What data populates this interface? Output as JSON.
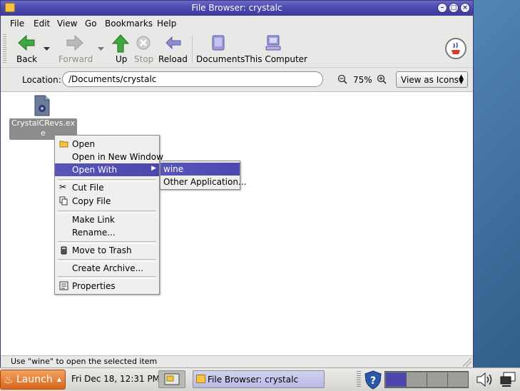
{
  "window": {
    "title": "File Browser: crystalc"
  },
  "menubar": [
    {
      "label": "File"
    },
    {
      "label": "Edit"
    },
    {
      "label": "View"
    },
    {
      "label": "Go"
    },
    {
      "label": "Bookmarks"
    },
    {
      "label": "Help"
    }
  ],
  "toolbar": {
    "back": "Back",
    "forward": "Forward",
    "up": "Up",
    "stop": "Stop",
    "reload": "Reload",
    "documents": "Documents",
    "this_computer": "This Computer"
  },
  "location": {
    "label": "Location:",
    "value": "/Documents/crystalc",
    "zoom": "75%",
    "view_mode": "View as Icons"
  },
  "file": {
    "name": "CrystalCRevs.exe"
  },
  "context_menu": {
    "open": "Open",
    "open_new_window": "Open in New Window",
    "open_with": "Open With",
    "cut": "Cut File",
    "copy": "Copy File",
    "make_link": "Make Link",
    "rename": "Rename...",
    "trash": "Move to Trash",
    "archive": "Create Archive...",
    "properties": "Properties"
  },
  "submenu": {
    "wine": "wine",
    "other": "Other Application..."
  },
  "status": "Use \"wine\" to open the selected item",
  "panel": {
    "launch": "Launch",
    "clock": "Fri Dec 18, 12:31 PM",
    "task": "File Browser: crystalc"
  },
  "colors": {
    "titlebar": "#4b47ad",
    "highlight": "#5a55bb",
    "launch": "#e07a30"
  }
}
